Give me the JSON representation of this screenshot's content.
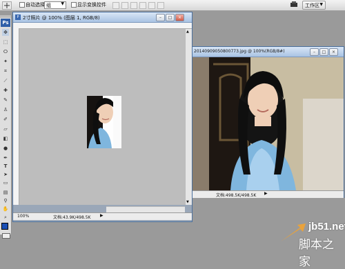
{
  "options_bar": {
    "auto_select_label": "自动选择:",
    "auto_select_value": "组",
    "show_transform_label": "显示变换控件",
    "workspace_label": "工作区"
  },
  "tools": {
    "ps_logo": "Ps",
    "type_tool": "T"
  },
  "window1": {
    "title": "2寸照片 @ 100% (图层 1, RGB/8)",
    "zoom": "100%",
    "doc_info": "文档:43.9K/498.5K"
  },
  "window2": {
    "title": "20140909050800773.jpg @ 100%(RGB/8#)",
    "doc_info": "文档:498.5K/498.5K"
  },
  "watermark": {
    "site": "jb51.net",
    "name": "脚本之家"
  }
}
